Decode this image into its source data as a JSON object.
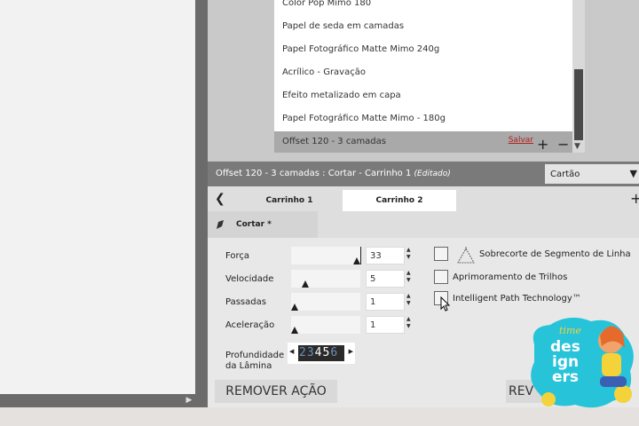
{
  "materials": {
    "items": [
      "Color Pop Mimo 180",
      "Papel de seda em camadas",
      "Papel Fotográfico Matte Mimo 240g",
      "Acrílico - Gravação",
      "Efeito metalizado em capa",
      "Papel Fotográfico Matte Mimo - 180g"
    ],
    "selected": "Offset 120 - 3 camadas",
    "save_label": "Salvar",
    "add_label": "+",
    "remove_label": "−"
  },
  "action_header": {
    "title": "Offset 120 - 3 camadas : Cortar - Carrinho 1",
    "edited": "(Editado)",
    "mode_value": "Cartão"
  },
  "carriages": {
    "tab1": "Carrinho 1",
    "tab2": "Carrinho 2",
    "add": "+"
  },
  "cut_tab": {
    "label": "Cortar *"
  },
  "params": {
    "force": {
      "label": "Força",
      "value": "33"
    },
    "speed": {
      "label": "Velocidade",
      "value": "5"
    },
    "passes": {
      "label": "Passadas",
      "value": "1"
    },
    "accel": {
      "label": "Aceleração",
      "value": "1"
    }
  },
  "options": {
    "overcut": "Sobrecorte de Segmento de Linha",
    "trail": "Aprimoramento de Trilhos",
    "ipt": "Intelligent Path Technology™"
  },
  "blade": {
    "label_line1": "Profundidade",
    "label_line2": "da Lâmina",
    "digits_before": "23",
    "digit_current": "4",
    "digits_after": "5",
    "digits_tail": "6"
  },
  "buttons": {
    "remove_action": "REMOVER AÇÃO",
    "review": "REV"
  },
  "logo": {
    "line1": "time",
    "line2": "des",
    "line3": "ign",
    "line4": "ers"
  },
  "colors": {
    "header_bg": "#7a7a7a",
    "save_link": "#b21e1e",
    "logo_cyan": "#27c3d9",
    "logo_yellow": "#f4d23a"
  }
}
